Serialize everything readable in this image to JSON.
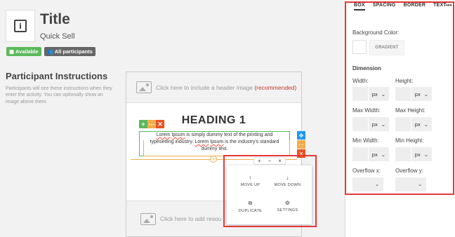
{
  "header": {
    "title": "Title",
    "subtitle": "Quick Sell",
    "icon": "info-icon",
    "badges": [
      {
        "label": "Available",
        "icon": "calendar-icon",
        "color": "#5cb85c"
      },
      {
        "label": "All participants",
        "icon": "users-icon",
        "color": "#666666"
      }
    ]
  },
  "instructions": {
    "title": "Participant Instructions",
    "description": "Participants will see these instructions when they enter the activity. You can optionally show an image above them."
  },
  "canvas": {
    "header_image_text": "Click here to include a header image",
    "header_image_recommended": "(recommended)",
    "heading": "HEADING 1",
    "body_text_parts": [
      "Lorem",
      " ",
      "Ipsum",
      " is simply dummy text of the printing and typesetting industry. ",
      "Lorem",
      " ",
      "Ipsum",
      " is the industry's standard dummy text."
    ],
    "bottom_image_text": "Click here to add resou",
    "toolbar": {
      "add": "+",
      "more": "⋯",
      "remove": "✕"
    },
    "side_toolbar": {
      "move": "✥",
      "more": "⋯",
      "remove": "✕"
    },
    "add_below": "+"
  },
  "popup": {
    "mini": {
      "add": "+",
      "minus": "−",
      "close": "×"
    },
    "actions": [
      {
        "label": "MOVE UP",
        "icon": "↑"
      },
      {
        "label": "MOVE DOWN",
        "icon": "↓"
      },
      {
        "label": "DUPLICATE",
        "icon": "⧉"
      },
      {
        "label": "SETTINGS",
        "icon": "⚙"
      }
    ]
  },
  "panel": {
    "tabs": [
      "BOX",
      "SPACING",
      "BORDER",
      "TEXT"
    ],
    "active_tab": "BOX",
    "more": "•••",
    "background_color_label": "Background Color:",
    "gradient_label": "GRADIENT",
    "dimension_label": "Dimension",
    "fields": [
      {
        "label": "Width:",
        "unit": "px"
      },
      {
        "label": "Height:",
        "unit": "px"
      },
      {
        "label": "Max Width:",
        "unit": "px"
      },
      {
        "label": "Max Height:",
        "unit": "px"
      },
      {
        "label": "Min Width:",
        "unit": "px"
      },
      {
        "label": "Min Height:",
        "unit": "px"
      }
    ],
    "overflow_x_label": "Overflow x:",
    "overflow_y_label": "Overflow y:"
  },
  "colors": {
    "accent_green": "#5cb85c",
    "accent_orange": "#f0ad4e",
    "accent_red": "#e95420",
    "highlight": "#e53935",
    "move_blue": "#2196f3"
  }
}
